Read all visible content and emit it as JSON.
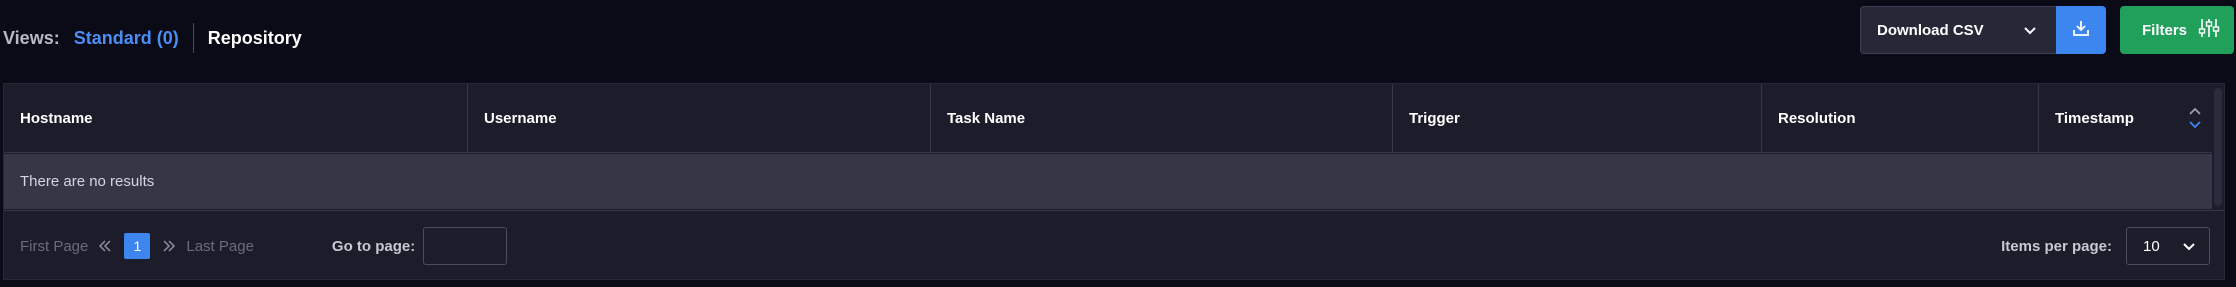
{
  "views": {
    "label": "Views:",
    "standard": "Standard (0)",
    "repository": "Repository"
  },
  "toolbar": {
    "download_label": "Download CSV",
    "filters_label": "Filters",
    "icons": {
      "download_chevron": "chevron-down-icon",
      "download": "download-icon",
      "filters": "sliders-icon"
    },
    "colors": {
      "accent_blue": "#3d86f0",
      "filters_green": "#20a05a",
      "link_blue": "#4a8ef5"
    }
  },
  "table": {
    "columns": [
      "Hostname",
      "Username",
      "Task Name",
      "Trigger",
      "Resolution",
      "Timestamp"
    ],
    "sorted_column": "Timestamp",
    "empty_message": "There are no results"
  },
  "pagination": {
    "first_page": "First Page",
    "last_page": "Last Page",
    "current_page": "1",
    "goto_label": "Go to page:",
    "goto_value": "",
    "items_per_page_label": "Items per page:",
    "items_per_page_value": "10"
  }
}
